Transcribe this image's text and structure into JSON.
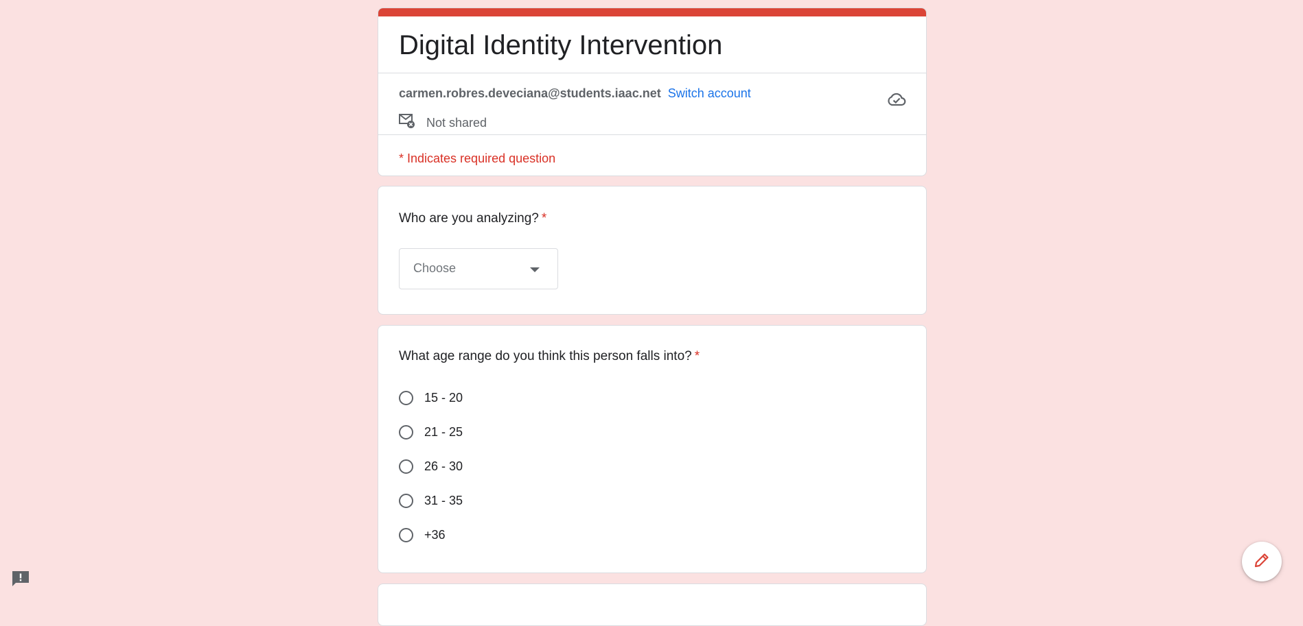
{
  "form": {
    "title": "Digital Identity Intervention",
    "account_email": "carmen.robres.deveciana@students.iaac.net",
    "switch_account": "Switch account",
    "share_status": "Not shared",
    "required_note": "* Indicates required question"
  },
  "questions": [
    {
      "title": "Who are you analyzing?",
      "required_mark": "*",
      "type": "dropdown",
      "placeholder": "Choose"
    },
    {
      "title": "What age range do you think this person falls into?",
      "required_mark": "*",
      "type": "radio",
      "options": [
        "15 - 20",
        "21 - 25",
        "26 - 30",
        "31 - 35",
        "+36"
      ]
    }
  ],
  "icons": {
    "cloud": "cloud-check-icon",
    "share": "mail-not-shared-icon",
    "dropdown": "chevron-down-icon",
    "edit": "pencil-icon",
    "feedback": "feedback-icon"
  },
  "colors": {
    "accent": "#db4437",
    "background": "#fbe1e1",
    "link": "#1a73e8",
    "required": "#d93025",
    "edit_icon": "#db4437"
  }
}
